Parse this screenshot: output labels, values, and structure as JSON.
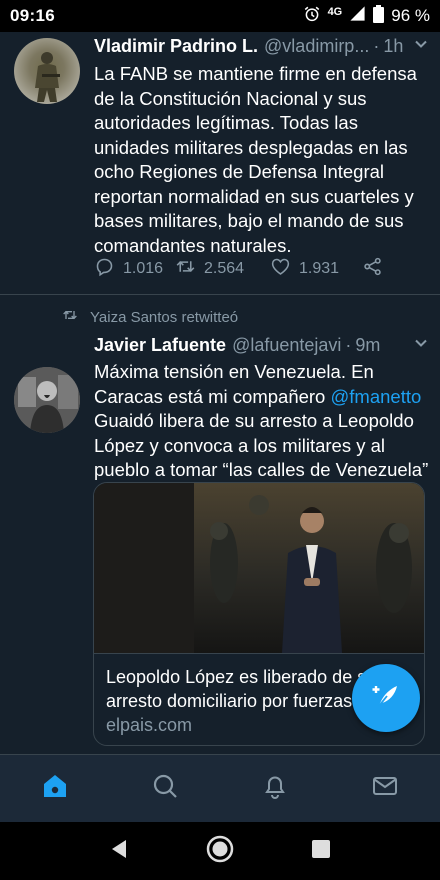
{
  "status": {
    "time": "09:16",
    "network": "4G",
    "battery": "96 %"
  },
  "tweets": [
    {
      "name": "Vladimir Padrino L.",
      "handle": "@vladimirp...",
      "sep": "·",
      "time": "1h",
      "text": "La FANB se mantiene firme en defensa de la Constitución Nacional y sus autoridades legítimas. Todas las unidades militares desplegadas en las ocho Regiones de Defensa Integral reportan normalidad en sus cuarteles y bases militares, bajo el mando de sus comandantes naturales.",
      "replies": "1.016",
      "retweets": "2.564",
      "likes": "1.931"
    },
    {
      "retweeted_by": "Yaiza Santos retwitteó",
      "name": "Javier Lafuente",
      "handle": "@lafuentejavi",
      "sep": "·",
      "time": "9m",
      "text_before": "Máxima tensión en Venezuela. En Caracas está mi compañero ",
      "mention": "@fmanetto",
      "text_after": " Guaidó libera de su arresto a Leopoldo López y convoca a los militares y al pueblo a tomar “las calles de Venezuela”",
      "card": {
        "title": "Leopoldo López es liberado de su arresto domiciliario por fuerzas...",
        "domain": "elpais.com"
      }
    }
  ],
  "colors": {
    "background": "#15202b",
    "accent": "#1da1f2",
    "muted": "#8899a6"
  }
}
